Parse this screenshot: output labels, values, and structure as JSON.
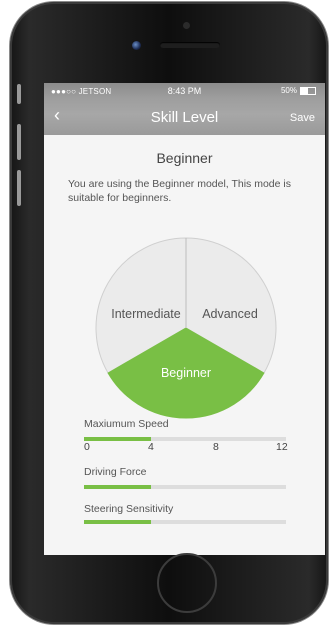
{
  "status_bar": {
    "carrier": "●●●○○ JETSON",
    "time": "8:43 PM",
    "battery_text": "50%",
    "battery_level": 0.5
  },
  "nav": {
    "back_symbol": "‹",
    "title": "Skill Level",
    "save_label": "Save"
  },
  "mode": {
    "title": "Beginner",
    "description": "You are using the Beginner model,  This mode is suitable for beginners."
  },
  "skill_selector": {
    "segments": [
      {
        "label": "Intermediate",
        "selected": false
      },
      {
        "label": "Advanced",
        "selected": false
      },
      {
        "label": "Beginner",
        "selected": true
      }
    ]
  },
  "settings": {
    "max_speed": {
      "label": "Maxiumum Speed",
      "ticks": [
        "0",
        "4",
        "8",
        "12"
      ],
      "value": 4,
      "max": 12
    },
    "driving_force": {
      "label": "Driving Force",
      "level": 0.33
    },
    "steering_sensitivity": {
      "label": "Steering Sensitivity",
      "level": 0.33
    }
  },
  "colors": {
    "accent": "#79bf45",
    "header": "#9e9e9e",
    "segment_inactive": "#ebebeb"
  }
}
